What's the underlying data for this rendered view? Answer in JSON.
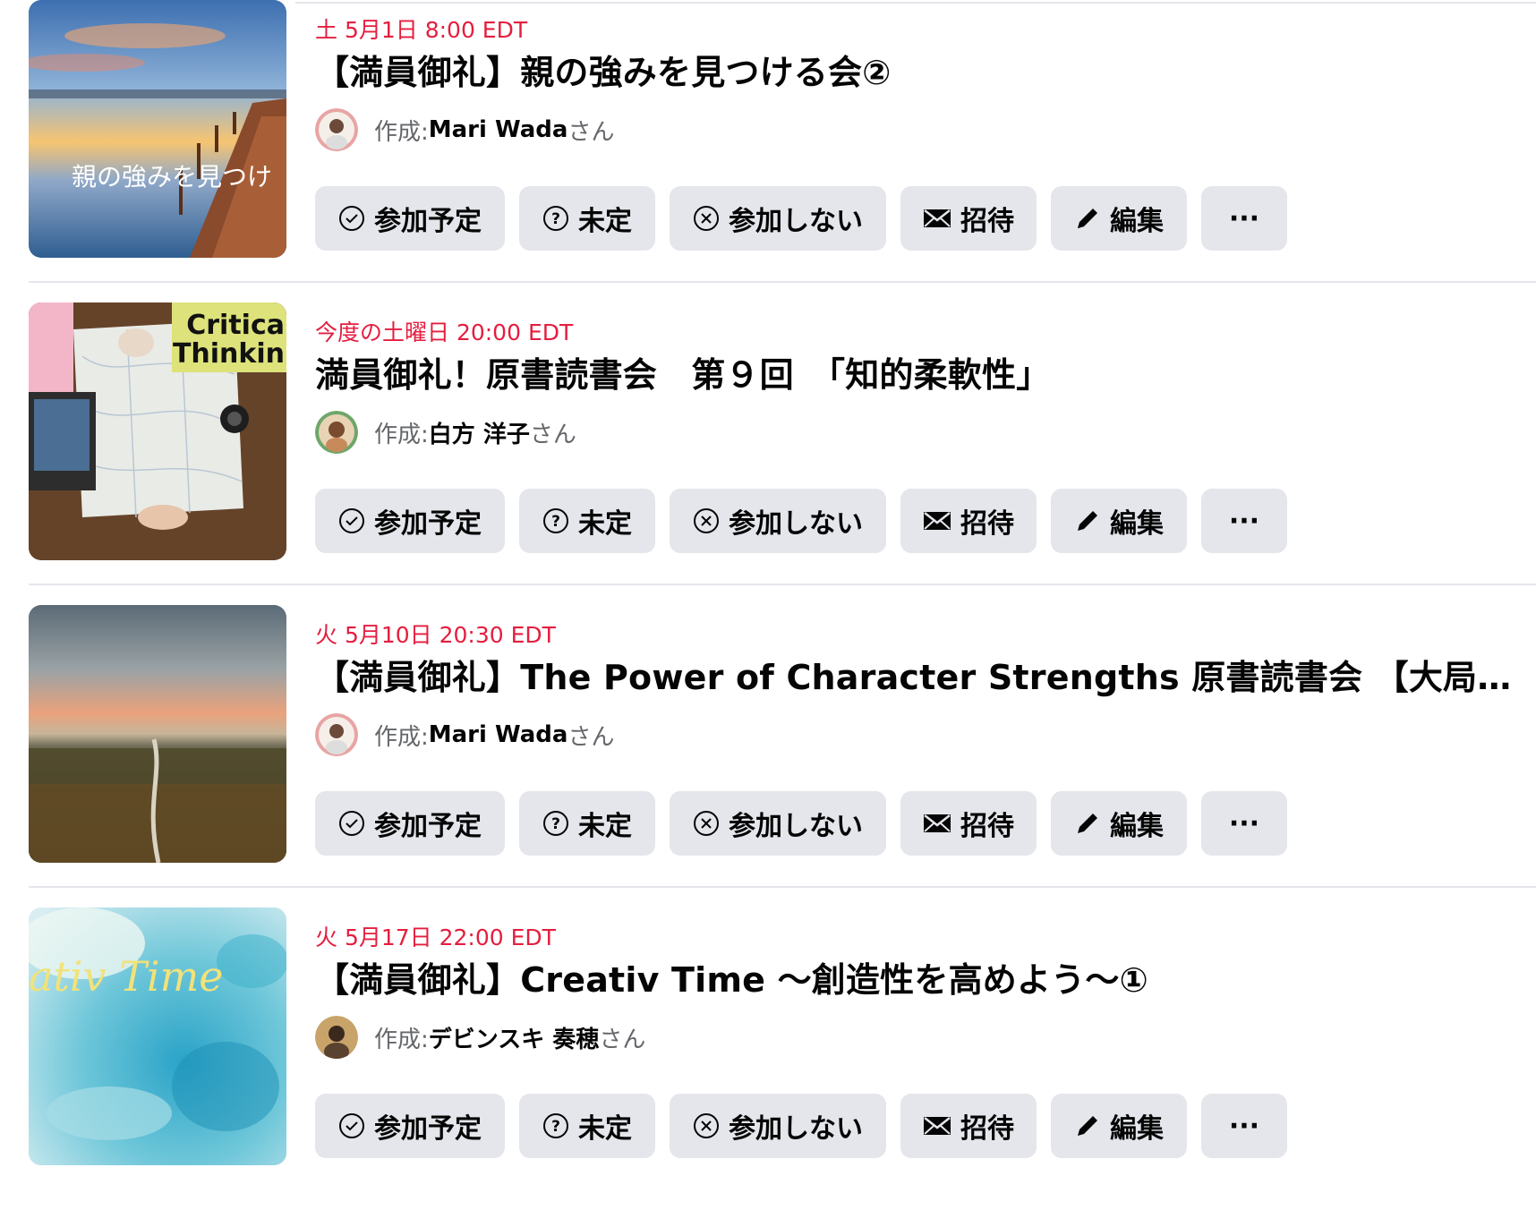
{
  "labels": {
    "creator_prefix": "作成: ",
    "creator_suffix": "さん",
    "going": "参加予定",
    "maybe": "未定",
    "decline": "参加しない",
    "invite": "招待",
    "edit": "編集",
    "more": "···"
  },
  "colors": {
    "date": "#e41e3f",
    "button_bg": "#e4e6eb",
    "divider": "#e4e6eb"
  },
  "events": [
    {
      "date": "土 5月1日 8:00 EDT",
      "title": "【満員御礼】親の強みを見つける会②",
      "creator": "Mari Wada",
      "thumbnail_text": "親の強みを見つけ",
      "thumbnail_icon": "lake-pier-sunset-image"
    },
    {
      "date": "今度の土曜日 20:00 EDT",
      "title": "満員御礼！原書読書会　第９回　「知的柔軟性」",
      "creator": "白方 洋子",
      "thumbnail_text": "Critica Thinkin",
      "thumbnail_icon": "map-desk-image"
    },
    {
      "date": "火 5月10日 20:30 EDT",
      "title": "【満員御礼】The Power of Character Strengths 原書読書会 【大局観 / P...",
      "creator": "Mari Wada",
      "thumbnail_text": "",
      "thumbnail_icon": "forest-road-sunset-image"
    },
    {
      "date": "火 5月17日 22:00 EDT",
      "title": "【満員御礼】Creativ Time ～創造性を高めよう～①",
      "creator": "デビンスキ 奏穂",
      "thumbnail_text": "ativ Time",
      "thumbnail_icon": "watercolor-image"
    }
  ]
}
